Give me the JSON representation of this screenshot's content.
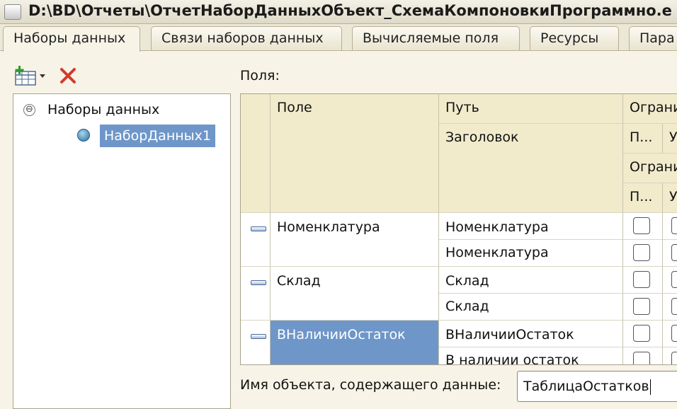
{
  "window": {
    "title": "D:\\BD\\Отчеты\\ОтчетНаборДанныхОбъект_СхемаКомпоновкиПрограммно.e"
  },
  "tabs": [
    {
      "label": "Наборы данных",
      "active": true
    },
    {
      "label": "Связи наборов данных",
      "active": false
    },
    {
      "label": "Вычисляемые поля",
      "active": false
    },
    {
      "label": "Ресурсы",
      "active": false
    },
    {
      "label": "Пара",
      "active": false
    }
  ],
  "toolbar": {
    "add_icon": "add-dataset-icon",
    "delete_icon": "delete-icon"
  },
  "tree": {
    "root": {
      "label": "Наборы данных",
      "toggle": "⊖"
    },
    "children": [
      {
        "label": "НаборДанных1",
        "selected": true,
        "icon": "dataset-object-icon"
      }
    ]
  },
  "fields": {
    "label": "Поля:",
    "headers": {
      "field": "Поле",
      "path": "Путь",
      "title": "Заголовок",
      "restriction1": "Ограни",
      "restriction2": "Ограни",
      "sub1": "П...",
      "sub2": "У",
      "sub3": "П...",
      "sub4": "У"
    },
    "rows": [
      {
        "field": "Номенклатура",
        "path": "Номенклатура",
        "title": "Номенклатура",
        "selected": false
      },
      {
        "field": "Склад",
        "path": "Склад",
        "title": "Склад",
        "selected": false
      },
      {
        "field": "ВНаличииОстаток",
        "path": "ВНаличииОстаток",
        "title": "В наличии остаток",
        "selected": true
      }
    ]
  },
  "footer": {
    "object_label": "Имя объекта, содержащего данные:",
    "object_value": "ТаблицаОстатков"
  },
  "colors": {
    "background": "#f7f4e7",
    "selection": "#6e96c9",
    "header": "#f1ebcc"
  }
}
